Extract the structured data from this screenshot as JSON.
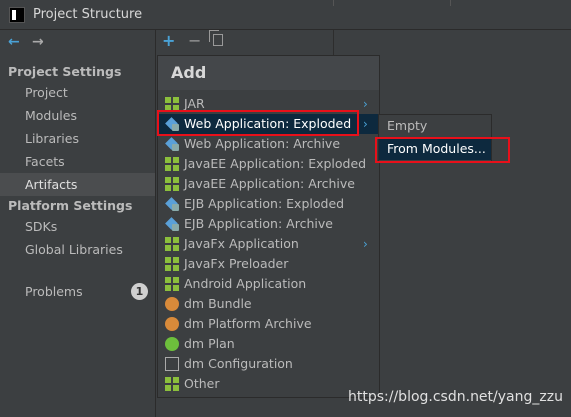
{
  "window": {
    "title": "Project Structure"
  },
  "sidebar": {
    "sections": [
      {
        "title": "Project Settings",
        "items": [
          "Project",
          "Modules",
          "Libraries",
          "Facets",
          "Artifacts"
        ]
      },
      {
        "title": "Platform Settings",
        "items": [
          "SDKs",
          "Global Libraries"
        ]
      }
    ],
    "selected": "Artifacts",
    "problems": {
      "label": "Problems",
      "count": "1"
    }
  },
  "toolbar": {
    "add_icon": "plus-icon",
    "remove_icon": "minus-icon",
    "copy_icon": "copy-icon"
  },
  "popup": {
    "title": "Add",
    "items": [
      {
        "label": "JAR",
        "icon": "grid-icon",
        "has_submenu": true
      },
      {
        "label": "Web Application: Exploded",
        "icon": "web-app-icon",
        "has_submenu": true,
        "selected": true
      },
      {
        "label": "Web Application: Archive",
        "icon": "web-app-icon"
      },
      {
        "label": "JavaEE Application: Exploded",
        "icon": "javaee-icon"
      },
      {
        "label": "JavaEE Application: Archive",
        "icon": "javaee-icon"
      },
      {
        "label": "EJB Application: Exploded",
        "icon": "ejb-icon"
      },
      {
        "label": "EJB Application: Archive",
        "icon": "ejb-icon"
      },
      {
        "label": "JavaFx Application",
        "icon": "grid-icon",
        "has_submenu": true
      },
      {
        "label": "JavaFx Preloader",
        "icon": "grid-icon"
      },
      {
        "label": "Android Application",
        "icon": "grid-icon"
      },
      {
        "label": "dm Bundle",
        "icon": "dm-bundle-icon"
      },
      {
        "label": "dm Platform Archive",
        "icon": "dm-platform-icon"
      },
      {
        "label": "dm Plan",
        "icon": "dm-plan-icon"
      },
      {
        "label": "dm Configuration",
        "icon": "dm-config-icon"
      },
      {
        "label": "Other",
        "icon": "grid-icon"
      }
    ]
  },
  "submenu": {
    "items": [
      "Empty",
      "From Modules..."
    ],
    "selected": "From Modules..."
  },
  "watermark": "https://blog.csdn.net/yang_zzu",
  "colors": {
    "accent": "#4aa2d6",
    "selection": "#0d293e",
    "highlight": "#e8101a",
    "background": "#3c3f41"
  }
}
